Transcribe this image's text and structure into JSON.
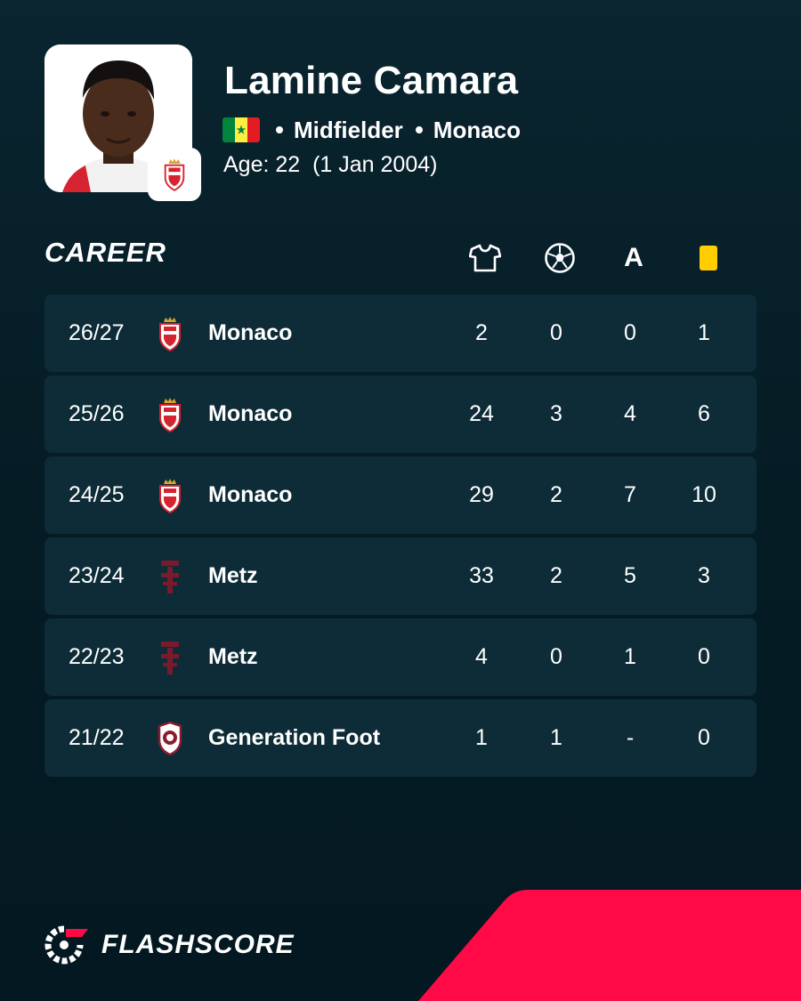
{
  "player": {
    "name": "Lamine Camara",
    "position": "Midfielder",
    "club": "Monaco",
    "age_label": "Age: 22",
    "birth_date": "(1 Jan 2004)",
    "nationality_flag": "senegal-flag"
  },
  "career": {
    "title": "CAREER",
    "columns": [
      {
        "icon": "shirt-icon",
        "label": ""
      },
      {
        "icon": "ball-icon",
        "label": ""
      },
      {
        "icon": "assists-icon",
        "label": "A"
      },
      {
        "icon": "yellow-card-icon",
        "label": ""
      }
    ],
    "rows": [
      {
        "season": "26/27",
        "club": "Monaco",
        "logo": "monaco-logo",
        "apps": "2",
        "goals": "0",
        "assists": "0",
        "yellow": "1"
      },
      {
        "season": "25/26",
        "club": "Monaco",
        "logo": "monaco-logo",
        "apps": "24",
        "goals": "3",
        "assists": "4",
        "yellow": "6"
      },
      {
        "season": "24/25",
        "club": "Monaco",
        "logo": "monaco-logo",
        "apps": "29",
        "goals": "2",
        "assists": "7",
        "yellow": "10"
      },
      {
        "season": "23/24",
        "club": "Metz",
        "logo": "metz-logo",
        "apps": "33",
        "goals": "2",
        "assists": "5",
        "yellow": "3"
      },
      {
        "season": "22/23",
        "club": "Metz",
        "logo": "metz-logo",
        "apps": "4",
        "goals": "0",
        "assists": "1",
        "yellow": "0"
      },
      {
        "season": "21/22",
        "club": "Generation Foot",
        "logo": "generation-foot-logo",
        "apps": "1",
        "goals": "1",
        "assists": "-",
        "yellow": "0"
      }
    ]
  },
  "brand": {
    "name": "FLASHSCORE"
  },
  "colors": {
    "background": "#061d26",
    "row_background": "#0d2c37",
    "accent": "#ff0a46",
    "yellow_card": "#ffcd00",
    "monaco_red": "#d5232f",
    "metz_maroon": "#7a1a2b"
  }
}
